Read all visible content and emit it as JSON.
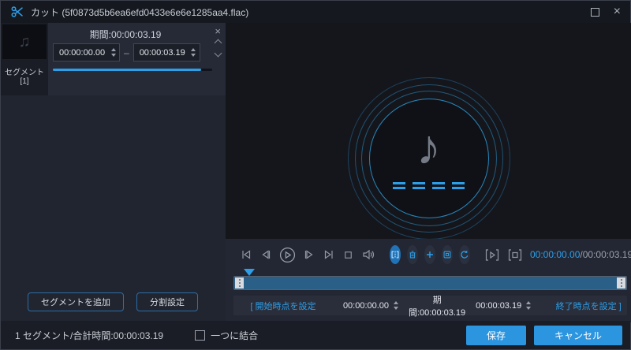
{
  "titlebar": {
    "title": "カット (5f0873d5b6ea6efd0433e6e6e1285aa4.flac)"
  },
  "segment_panel": {
    "segment_label": "セグメント[1]",
    "duration_text": "期間:00:00:03.19",
    "start_time": "00:00:00.00",
    "range_separator": "–",
    "end_time": "00:00:03.19",
    "add_segment_button": "セグメントを追加",
    "split_settings_button": "分割設定"
  },
  "player": {
    "current_time": "00:00:00.00",
    "total_time": "/00:00:03.19",
    "set_start_button": "[ 開始時点を設定",
    "start_time": "00:00:00.00",
    "duration_text": "期間:00:00:03.19",
    "end_time": "00:00:03.19",
    "set_end_button": "終了時点を設定 ]"
  },
  "footer": {
    "summary": "1 セグメント/合計時間:00:00:03.19",
    "merge_checkbox_label": "一つに結合",
    "merge_checked": false,
    "save_button": "保存",
    "cancel_button": "キャンセル"
  },
  "icons": {
    "music_note_big": "♪",
    "music_note_small": "♫",
    "close": "×",
    "card_close": "×"
  },
  "colors": {
    "accent_blue": "#2d9fe8",
    "button_blue": "#2b95e0",
    "timeline_fill": "#2a5f87",
    "background_dark": "#14161c",
    "panel_dark": "#232734"
  }
}
